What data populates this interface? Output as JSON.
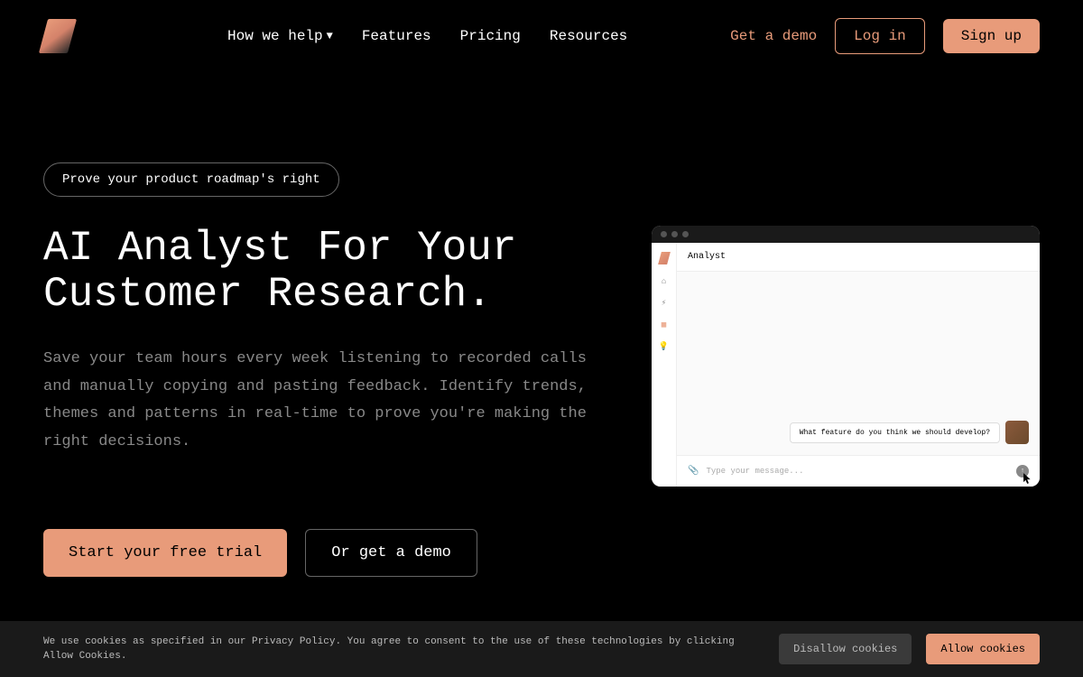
{
  "nav": {
    "how_we_help": "How we help",
    "features": "Features",
    "pricing": "Pricing",
    "resources": "Resources",
    "get_demo": "Get a demo",
    "log_in": "Log in",
    "sign_up": "Sign up"
  },
  "hero": {
    "pill": "Prove your product roadmap's right",
    "headline": "AI Analyst For Your Customer Research.",
    "subhead": "Save your team hours every week listening to recorded calls and manually copying and pasting feedback. Identify trends, themes and patterns in real-time to prove you're making the right decisions.",
    "cta_primary": "Start your free trial",
    "cta_secondary": "Or get a demo"
  },
  "app": {
    "title": "Analyst",
    "message": "What feature do you think we should develop?",
    "input_placeholder": "Type your message..."
  },
  "cookies": {
    "text": "We use cookies as specified in our Privacy Policy. You agree to consent to the use of these technologies by clicking Allow Cookies.",
    "disallow": "Disallow cookies",
    "allow": "Allow cookies"
  }
}
